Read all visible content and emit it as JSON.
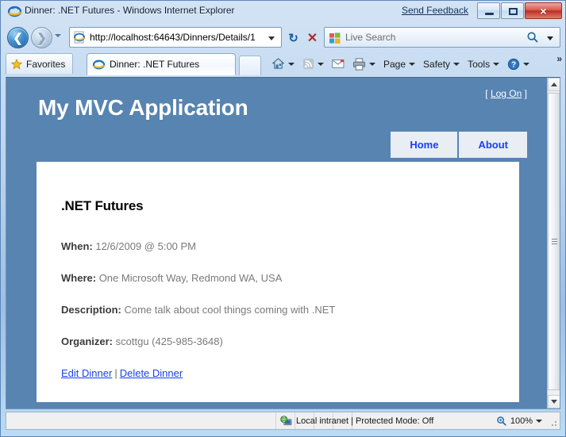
{
  "browser": {
    "window_title": "Dinner: .NET Futures - Windows Internet Explorer",
    "send_feedback": "Send Feedback",
    "minimize_label": "Minimize",
    "maximize_label": "Restore Down",
    "close_label": "×",
    "back_glyph": "❮",
    "forward_glyph": "❯",
    "refresh_glyph": "↻",
    "stop_glyph": "✕",
    "address_url": "http://localhost:64643/Dinners/Details/1",
    "search_placeholder": "Live Search",
    "favorites_label": "Favorites",
    "tab_title": "Dinner: .NET Futures",
    "commands": [
      {
        "label": "Page",
        "has_caret": true
      },
      {
        "label": "Safety",
        "has_caret": true
      },
      {
        "label": "Tools",
        "has_caret": true
      }
    ],
    "overflow_glyph": "»"
  },
  "status": {
    "zone": "Local intranet | Protected Mode: Off",
    "zoom": "100%"
  },
  "page": {
    "site_title": "My MVC Application",
    "logon_open_bracket": "[",
    "logon_link": "Log On",
    "logon_close_bracket": "]",
    "nav": [
      {
        "label": "Home"
      },
      {
        "label": "About"
      }
    ],
    "dinner": {
      "title": ".NET Futures",
      "fields": [
        {
          "label": "When:",
          "value": "12/6/2009 @ 5:00 PM"
        },
        {
          "label": "Where:",
          "value": "One Microsoft Way, Redmond WA, USA"
        },
        {
          "label": "Description:",
          "value": "Come talk about cool things coming with .NET"
        },
        {
          "label": "Organizer:",
          "value": "scottgu (425-985-3648)"
        }
      ],
      "edit_link": "Edit Dinner",
      "link_separator": "|",
      "delete_link": "Delete Dinner"
    }
  },
  "colors": {
    "page_header_blue": "#5884b1",
    "nav_tab_bg": "#e8eef4",
    "link_blue": "#1a3ff5",
    "content_bg": "#ffffff"
  }
}
